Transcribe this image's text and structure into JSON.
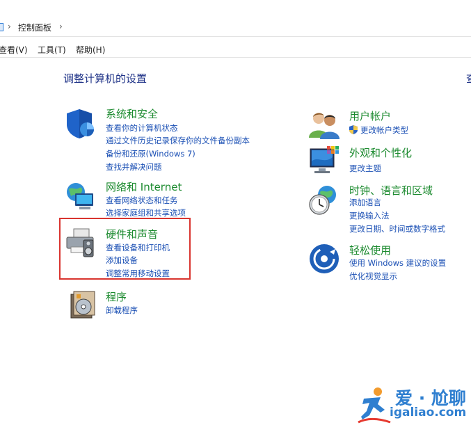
{
  "address_bar": {
    "crumb": "控制面板",
    "separator": "›"
  },
  "menu": {
    "view": "查看(V)",
    "tools": "工具(T)",
    "help": "帮助(H)"
  },
  "page": {
    "title": "调整计算机的设置",
    "right_clip": "查"
  },
  "categories": {
    "system": {
      "title": "系统和安全",
      "links": [
        "查看你的计算机状态",
        "通过文件历史记录保存你的文件备份副本",
        "备份和还原(Windows 7)",
        "查找并解决问题"
      ]
    },
    "network": {
      "title": "网络和 Internet",
      "links": [
        "查看网络状态和任务",
        "选择家庭组和共享选项"
      ]
    },
    "hardware": {
      "title": "硬件和声音",
      "links": [
        "查看设备和打印机",
        "添加设备",
        "调整常用移动设置"
      ]
    },
    "programs": {
      "title": "程序",
      "links": [
        "卸载程序"
      ]
    },
    "users": {
      "title": "用户帐户",
      "links": [
        "更改帐户类型"
      ]
    },
    "appearance": {
      "title": "外观和个性化",
      "links": [
        "更改主题"
      ]
    },
    "clock": {
      "title": "时钟、语言和区域",
      "links": [
        "添加语言",
        "更换输入法",
        "更改日期、时间或数字格式"
      ]
    },
    "ease": {
      "title": "轻松使用",
      "links": [
        "使用 Windows 建议的设置",
        "优化视觉显示"
      ]
    }
  },
  "watermark": {
    "line1": "爱 · 尬聊",
    "line2": "igaliao.com"
  },
  "colors": {
    "title_green": "#1b8a2e",
    "link_blue": "#1a4fb4",
    "heading_blue": "#1e3287",
    "highlight_red": "#d9342f"
  }
}
